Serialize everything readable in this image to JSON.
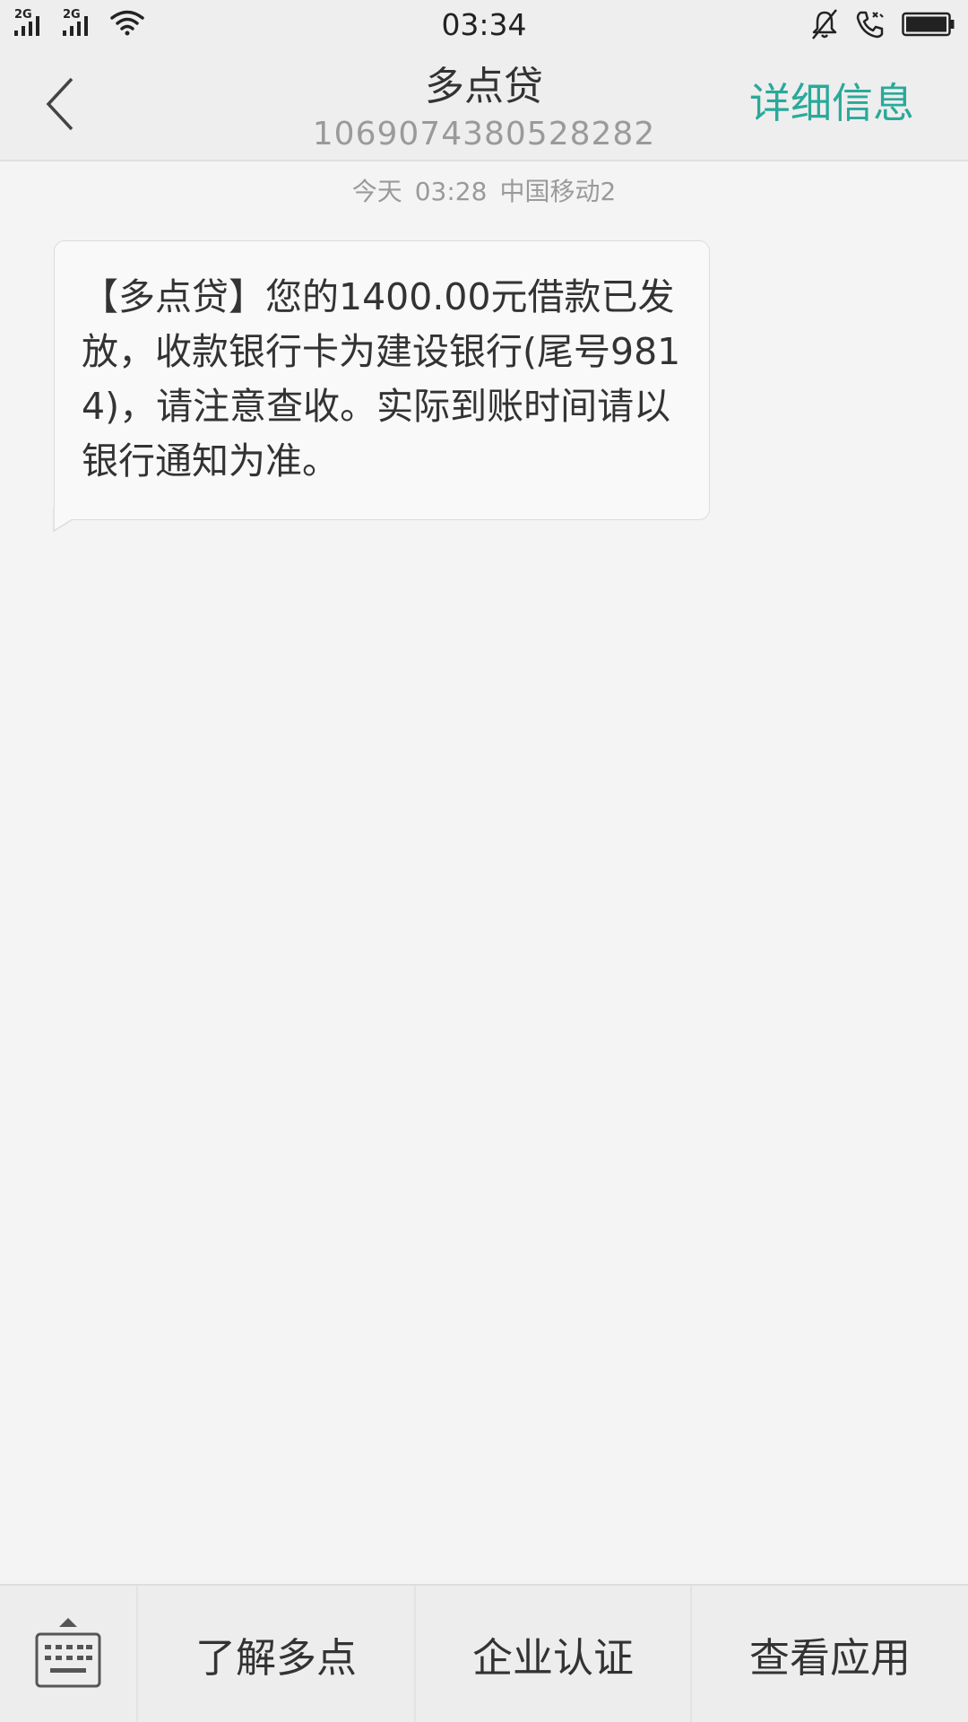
{
  "status_bar": {
    "sim1_network": "2G",
    "sim2_network": "2G",
    "time": "03:34"
  },
  "header": {
    "title": "多点贷",
    "number": "1069074380528282",
    "detail_label": "详细信息"
  },
  "message": {
    "day": "今天",
    "time": "03:28",
    "carrier": "中国移动2",
    "text": "【多点贷】您的1400.00元借款已发放，收款银行卡为建设银行(尾号9814)，请注意查收。实际到账时间请以银行通知为准。"
  },
  "bottom_menu": {
    "keyboard_icon": "keyboard-icon",
    "items": [
      {
        "label": "了解多点"
      },
      {
        "label": "企业认证"
      },
      {
        "label": "查看应用"
      }
    ]
  },
  "colors": {
    "accent": "#2aa99a",
    "background": "#f4f4f4",
    "bar": "#eeeeee"
  }
}
